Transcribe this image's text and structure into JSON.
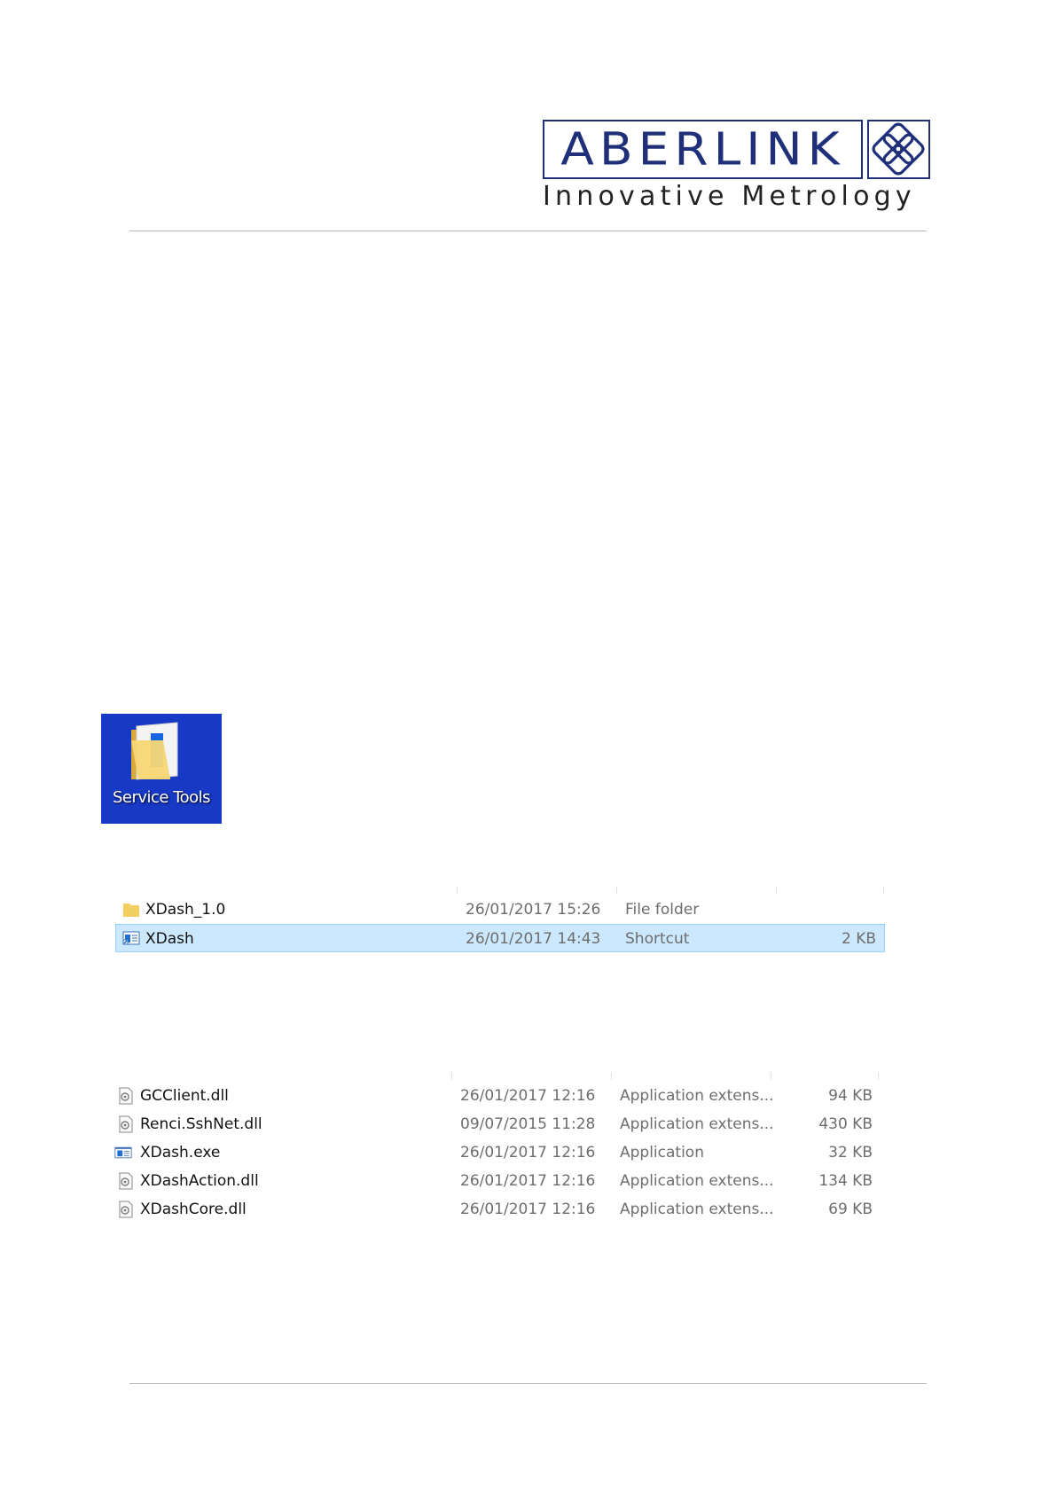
{
  "header": {
    "logo_word": "ABERLINK",
    "tagline": "Innovative Metrology",
    "brand_color": "#1f2f7a"
  },
  "desktop_shortcut": {
    "label": "Service Tools",
    "icon": "folder-icon",
    "background": "#1739c6"
  },
  "folder_listing": {
    "rows": [
      {
        "icon": "folder-icon",
        "name": "XDash_1.0",
        "date": "26/01/2017 15:26",
        "type": "File folder",
        "size": "",
        "selected": false
      },
      {
        "icon": "shortcut-icon",
        "name": "XDash",
        "date": "26/01/2017 14:43",
        "type": "Shortcut",
        "size": "2 KB",
        "selected": true
      }
    ]
  },
  "install_listing": {
    "rows": [
      {
        "icon": "dll-file-icon",
        "name": "GCClient.dll",
        "date": "26/01/2017 12:16",
        "type": "Application extens...",
        "size": "94 KB"
      },
      {
        "icon": "dll-file-icon",
        "name": "Renci.SshNet.dll",
        "date": "09/07/2015 11:28",
        "type": "Application extens...",
        "size": "430 KB"
      },
      {
        "icon": "exe-file-icon",
        "name": "XDash.exe",
        "date": "26/01/2017 12:16",
        "type": "Application",
        "size": "32 KB"
      },
      {
        "icon": "dll-file-icon",
        "name": "XDashAction.dll",
        "date": "26/01/2017 12:16",
        "type": "Application extens...",
        "size": "134 KB"
      },
      {
        "icon": "dll-file-icon",
        "name": "XDashCore.dll",
        "date": "26/01/2017 12:16",
        "type": "Application extens...",
        "size": "69 KB"
      }
    ]
  }
}
